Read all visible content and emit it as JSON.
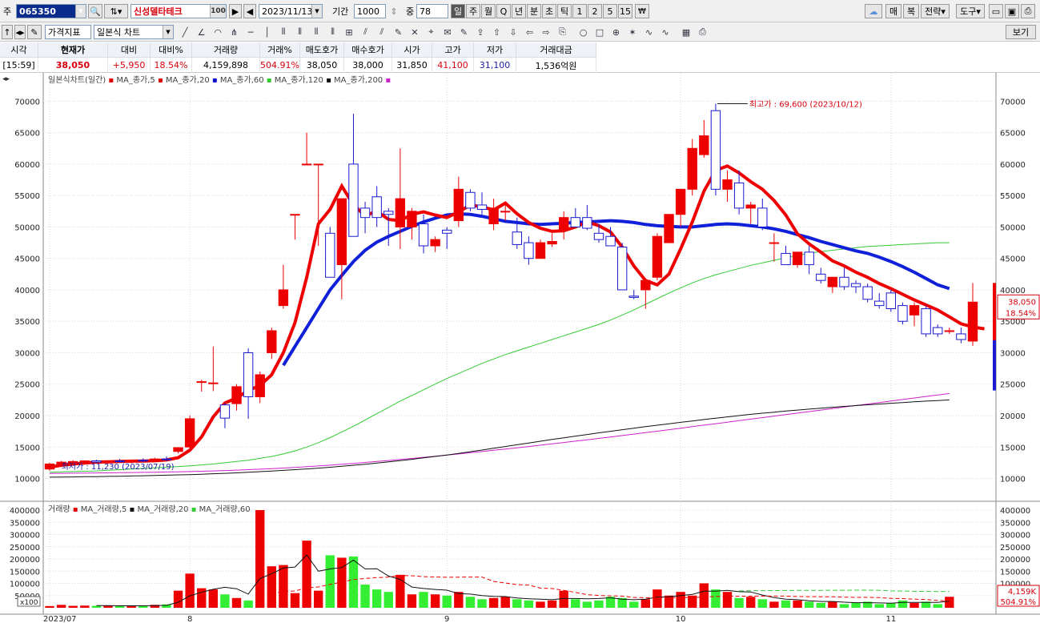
{
  "toolbar": {
    "market_label": "주",
    "stock_code": "065350",
    "stock_name": "신성델타테크",
    "name_badge": "100",
    "date": "2023/11/13",
    "period_label": "기간",
    "period_value": "1000",
    "count_label": "중",
    "count_value": "78",
    "periods": [
      "일",
      "주",
      "월",
      "Q",
      "년",
      "분",
      "초",
      "틱",
      "1",
      "2",
      "5",
      "15"
    ],
    "currency_label": "₩",
    "right_buttons": [
      "매",
      "복",
      "전략",
      "도구"
    ],
    "indicator_select": "가격지표",
    "chart_select": "일본식 차트",
    "view_button": "보기"
  },
  "quote": {
    "headers": [
      "시각",
      "현재가",
      "대비",
      "대비%",
      "거래량",
      "거래%",
      "매도호가",
      "매수호가",
      "시가",
      "고가",
      "저가",
      "거래대금"
    ],
    "values": [
      "[15:59]",
      "38,050",
      "+5,950",
      "18.54%",
      "4,159,898",
      "504.91%",
      "38,050",
      "38,000",
      "31,850",
      "41,100",
      "31,100",
      "1,536억원"
    ]
  },
  "price_panel": {
    "title": "일본식차트(일간)",
    "legend": [
      {
        "label": "MA_종가,5",
        "color": "#e00000"
      },
      {
        "label": "MA_종가,20",
        "color": "#e00000"
      },
      {
        "label": "MA_종가,60",
        "color": "#1010d0"
      },
      {
        "label": "MA_종가,120",
        "color": "#33cc33"
      },
      {
        "label": "MA_종가,200",
        "color": "#111111"
      }
    ],
    "legend_trailing_color": "#cc22cc",
    "yticks": [
      "70000",
      "65000",
      "60000",
      "55000",
      "50000",
      "45000",
      "40000",
      "35000",
      "30000",
      "25000",
      "20000",
      "15000",
      "10000"
    ],
    "high_annotation": "최고가 : 69,600 (2023/10/12)",
    "low_annotation": "최저가 : 11,230 (2023/07/19)",
    "price_tag": "38,050",
    "pct_tag": "18.54%"
  },
  "volume_panel": {
    "title": "거래량",
    "legend": [
      {
        "label": "MA_거래량,5",
        "color": "#e00000"
      },
      {
        "label": "MA_거래량,20",
        "color": "#111111"
      },
      {
        "label": "MA_거래량,60",
        "color": "#33cc33"
      }
    ],
    "yticks": [
      "400000",
      "350000",
      "300000",
      "250000",
      "200000",
      "150000",
      "100000",
      "50000"
    ],
    "unit_label": "x100",
    "volume_tag": "4,159K",
    "pct_tag": "504.91%"
  },
  "xaxis": {
    "labels": [
      "2023/07",
      "8",
      "9",
      "10",
      "11"
    ]
  },
  "colors": {
    "up": "#ee0000",
    "down": "#1a1ad0",
    "ma5": "#ee0000",
    "ma20": "#ee0000",
    "ma60": "#1020d8",
    "ma120": "#33cc33",
    "ma200": "#111111",
    "ma_last": "#cc22cc",
    "vol_up": "#ee0000",
    "vol_down": "#33ee33"
  },
  "chart_data": {
    "type": "candlestick",
    "ylim": [
      6500,
      74000
    ],
    "vol_ylim": [
      0,
      400000
    ],
    "candles": [
      {
        "o": 11500,
        "h": 12500,
        "l": 11200,
        "c": 12300
      },
      {
        "o": 12300,
        "h": 12800,
        "l": 12000,
        "c": 12600
      },
      {
        "o": 12500,
        "h": 12900,
        "l": 12200,
        "c": 12700
      },
      {
        "o": 12600,
        "h": 12900,
        "l": 12300,
        "c": 12800
      },
      {
        "o": 12800,
        "h": 13000,
        "l": 12400,
        "c": 12600
      },
      {
        "o": 12600,
        "h": 12900,
        "l": 12300,
        "c": 12800
      },
      {
        "o": 12800,
        "h": 13100,
        "l": 12500,
        "c": 12700
      },
      {
        "o": 12700,
        "h": 13000,
        "l": 12400,
        "c": 12900
      },
      {
        "o": 12900,
        "h": 13200,
        "l": 12600,
        "c": 12800
      },
      {
        "o": 12800,
        "h": 13300,
        "l": 12600,
        "c": 13100
      },
      {
        "o": 13100,
        "h": 13500,
        "l": 12800,
        "c": 13000
      },
      {
        "o": 14300,
        "h": 15000,
        "l": 14000,
        "c": 14900
      },
      {
        "o": 15000,
        "h": 20000,
        "l": 14800,
        "c": 19500
      },
      {
        "o": 25400,
        "h": 25700,
        "l": 23800,
        "c": 25400
      },
      {
        "o": 25200,
        "h": 31000,
        "l": 23900,
        "c": 25200
      },
      {
        "o": 21700,
        "h": 22000,
        "l": 18000,
        "c": 19600
      },
      {
        "o": 21900,
        "h": 25000,
        "l": 20800,
        "c": 24600
      },
      {
        "o": 30000,
        "h": 30700,
        "l": 19500,
        "c": 23000
      },
      {
        "o": 23000,
        "h": 27000,
        "l": 22000,
        "c": 26500
      },
      {
        "o": 30000,
        "h": 34000,
        "l": 29000,
        "c": 33500
      },
      {
        "o": 37500,
        "h": 44000,
        "l": 37000,
        "c": 40000
      },
      {
        "o": 52000,
        "h": 52000,
        "l": 48000,
        "c": 52000
      },
      {
        "o": 60000,
        "h": 65000,
        "l": 60000,
        "c": 60000
      },
      {
        "o": 60000,
        "h": 60000,
        "l": 47000,
        "c": 60000
      },
      {
        "o": 49000,
        "h": 50000,
        "l": 42000,
        "c": 42000
      },
      {
        "o": 44000,
        "h": 54500,
        "l": 38500,
        "c": 54500
      },
      {
        "o": 60000,
        "h": 68000,
        "l": 48500,
        "c": 48500
      },
      {
        "o": 53000,
        "h": 54000,
        "l": 49000,
        "c": 51500
      },
      {
        "o": 54800,
        "h": 56500,
        "l": 50000,
        "c": 51500
      },
      {
        "o": 52500,
        "h": 53000,
        "l": 47000,
        "c": 52000
      },
      {
        "o": 50000,
        "h": 62500,
        "l": 46500,
        "c": 54500
      },
      {
        "o": 50000,
        "h": 53000,
        "l": 48000,
        "c": 52500
      },
      {
        "o": 50500,
        "h": 52000,
        "l": 45800,
        "c": 47000
      },
      {
        "o": 47000,
        "h": 48500,
        "l": 46000,
        "c": 48000
      },
      {
        "o": 49500,
        "h": 50000,
        "l": 46500,
        "c": 49000
      },
      {
        "o": 51000,
        "h": 58000,
        "l": 50000,
        "c": 56000
      },
      {
        "o": 55500,
        "h": 56000,
        "l": 52500,
        "c": 53000
      },
      {
        "o": 53500,
        "h": 55500,
        "l": 52000,
        "c": 52800
      },
      {
        "o": 50500,
        "h": 54500,
        "l": 49500,
        "c": 53000
      },
      {
        "o": 52500,
        "h": 54000,
        "l": 51000,
        "c": 52500
      },
      {
        "o": 49200,
        "h": 51500,
        "l": 46500,
        "c": 47200
      },
      {
        "o": 47500,
        "h": 48500,
        "l": 44000,
        "c": 45000
      },
      {
        "o": 45000,
        "h": 48000,
        "l": 45000,
        "c": 47500
      },
      {
        "o": 47300,
        "h": 49000,
        "l": 46800,
        "c": 47700
      },
      {
        "o": 49500,
        "h": 52500,
        "l": 48000,
        "c": 51500
      },
      {
        "o": 51500,
        "h": 53000,
        "l": 50000,
        "c": 50000
      },
      {
        "o": 51500,
        "h": 53500,
        "l": 49500,
        "c": 49800
      },
      {
        "o": 49000,
        "h": 50500,
        "l": 47500,
        "c": 48000
      },
      {
        "o": 48500,
        "h": 50000,
        "l": 47000,
        "c": 47000
      },
      {
        "o": 46800,
        "h": 47500,
        "l": 40000,
        "c": 40000
      },
      {
        "o": 39000,
        "h": 40000,
        "l": 38500,
        "c": 38800
      },
      {
        "o": 40000,
        "h": 41500,
        "l": 37000,
        "c": 41500
      },
      {
        "o": 42000,
        "h": 49000,
        "l": 41500,
        "c": 48500
      },
      {
        "o": 47500,
        "h": 52000,
        "l": 47500,
        "c": 52000
      },
      {
        "o": 52000,
        "h": 56000,
        "l": 50000,
        "c": 56000
      },
      {
        "o": 56000,
        "h": 64000,
        "l": 55000,
        "c": 62500
      },
      {
        "o": 61500,
        "h": 67000,
        "l": 61000,
        "c": 64500
      },
      {
        "o": 68500,
        "h": 69600,
        "l": 55000,
        "c": 56000
      },
      {
        "o": 56000,
        "h": 59000,
        "l": 54000,
        "c": 57500
      },
      {
        "o": 57000,
        "h": 59000,
        "l": 52000,
        "c": 53000
      },
      {
        "o": 53000,
        "h": 54000,
        "l": 50500,
        "c": 53500
      },
      {
        "o": 53000,
        "h": 54500,
        "l": 49500,
        "c": 50000
      },
      {
        "o": 47500,
        "h": 49000,
        "l": 44500,
        "c": 47500
      },
      {
        "o": 45800,
        "h": 47000,
        "l": 44000,
        "c": 44000
      },
      {
        "o": 44000,
        "h": 46000,
        "l": 43500,
        "c": 46000
      },
      {
        "o": 46000,
        "h": 47000,
        "l": 42500,
        "c": 44000
      },
      {
        "o": 42500,
        "h": 43500,
        "l": 41000,
        "c": 41500
      },
      {
        "o": 40500,
        "h": 41500,
        "l": 39500,
        "c": 42000
      },
      {
        "o": 42000,
        "h": 43500,
        "l": 40000,
        "c": 40500
      },
      {
        "o": 41000,
        "h": 41500,
        "l": 39500,
        "c": 40500
      },
      {
        "o": 40500,
        "h": 41000,
        "l": 38000,
        "c": 38500
      },
      {
        "o": 38200,
        "h": 39500,
        "l": 37000,
        "c": 37500
      },
      {
        "o": 39500,
        "h": 40000,
        "l": 36500,
        "c": 37000
      },
      {
        "o": 37500,
        "h": 38000,
        "l": 34500,
        "c": 35000
      },
      {
        "o": 36000,
        "h": 38000,
        "l": 34200,
        "c": 37500
      },
      {
        "o": 37000,
        "h": 37500,
        "l": 32500,
        "c": 33000
      },
      {
        "o": 34000,
        "h": 34500,
        "l": 32500,
        "c": 33000
      },
      {
        "o": 33500,
        "h": 34000,
        "l": 33000,
        "c": 33500
      },
      {
        "o": 33000,
        "h": 34000,
        "l": 31500,
        "c": 32100
      },
      {
        "o": 31850,
        "h": 41100,
        "l": 31100,
        "c": 38050
      }
    ],
    "volume": [
      7000,
      12000,
      8000,
      9000,
      8000,
      9000,
      7000,
      8000,
      9000,
      12000,
      14000,
      70000,
      140000,
      80000,
      75000,
      55000,
      40000,
      30000,
      400000,
      170000,
      175000,
      60000,
      275000,
      70000,
      215000,
      205000,
      210000,
      95000,
      75000,
      65000,
      135000,
      55000,
      65000,
      55000,
      50000,
      65000,
      45000,
      35000,
      40000,
      45000,
      35000,
      30000,
      25000,
      30000,
      70000,
      35000,
      25000,
      30000,
      45000,
      40000,
      25000,
      35000,
      75000,
      50000,
      65000,
      50000,
      100000,
      75000,
      65000,
      40000,
      45000,
      35000,
      25000,
      30000,
      30000,
      25000,
      20000,
      25000,
      15000,
      20000,
      25000,
      15000,
      20000,
      30000,
      20000,
      25000,
      15000,
      45000
    ],
    "ma5": [
      11800,
      12100,
      12300,
      12450,
      12600,
      12650,
      12700,
      12750,
      12780,
      12820,
      12950,
      13300,
      14500,
      16600,
      19800,
      22000,
      22800,
      24000,
      24800,
      26500,
      30000,
      34800,
      42000,
      50500,
      52800,
      56500,
      53500,
      51800,
      52500,
      51200,
      51000,
      52000,
      52400,
      51900,
      51500,
      52400,
      53500,
      53200,
      52700,
      53800,
      52100,
      50700,
      49800,
      49300,
      49400,
      50000,
      50800,
      50200,
      49200,
      46800,
      43800,
      41500,
      40800,
      42500,
      46500,
      50800,
      55700,
      59000,
      59700,
      58600,
      57200,
      56000,
      54200,
      51900,
      48900,
      47300,
      46000,
      44600,
      43800,
      42800,
      42000,
      41000,
      40200,
      39300,
      38400,
      37600,
      36800,
      35700,
      34600,
      34100,
      33800
    ],
    "ma20": [
      0,
      0,
      0,
      0,
      0,
      0,
      0,
      0,
      0,
      0,
      0,
      0,
      0,
      0,
      0,
      0,
      0,
      0,
      0,
      0,
      28000,
      31000,
      34000,
      37000,
      40000,
      42300,
      44500,
      46300,
      47600,
      48500,
      49300,
      50100,
      50800,
      51400,
      51900,
      52100,
      52000,
      51700,
      51300,
      50900,
      50700,
      50500,
      50400,
      50500,
      50600,
      50700,
      50800,
      50900,
      51000,
      50900,
      50700,
      50400,
      50200,
      50100,
      50000,
      50000,
      50200,
      50400,
      50500,
      50400,
      50200,
      50000,
      49700,
      49300,
      48800,
      48300,
      47700,
      47200,
      46700,
      46200,
      45800,
      45200,
      44500,
      43700,
      42800,
      41800,
      40800,
      40200
    ],
    "ma60": [
      11000,
      11050,
      11100,
      11150,
      11200,
      11300,
      11400,
      11500,
      11600,
      11700,
      11800,
      11900,
      12000,
      12150,
      12300,
      12500,
      12700,
      12900,
      13200,
      13500,
      13900,
      14400,
      15000,
      15700,
      16500,
      17400,
      18300,
      19300,
      20300,
      21300,
      22300,
      23200,
      24100,
      25000,
      25900,
      26700,
      27500,
      28300,
      29000,
      29700,
      30300,
      30900,
      31500,
      32100,
      32700,
      33300,
      33900,
      34500,
      35200,
      36000,
      36800,
      37700,
      38600,
      39500,
      40300,
      41100,
      41800,
      42400,
      42900,
      43400,
      43900,
      44300,
      44700,
      45100,
      45500,
      45800,
      46100,
      46300,
      46500,
      46700,
      46900,
      47000,
      47100,
      47200,
      47300,
      47400,
      47500,
      47500
    ],
    "ma120": [
      10200,
      10220,
      10250,
      10280,
      10300,
      10330,
      10360,
      10400,
      10440,
      10480,
      10520,
      10570,
      10620,
      10680,
      10750,
      10820,
      10900,
      10990,
      11080,
      11180,
      11290,
      11400,
      11520,
      11650,
      11790,
      11940,
      12100,
      12270,
      12450,
      12640,
      12840,
      13050,
      13270,
      13500,
      13740,
      13990,
      14250,
      14520,
      14800,
      15080,
      15360,
      15640,
      15920,
      16200,
      16470,
      16740,
      17000,
      17260,
      17510,
      17760,
      18000,
      18240,
      18470,
      18700,
      18930,
      19150,
      19370,
      19590,
      19800,
      20000,
      20200,
      20380,
      20550,
      20720,
      20880,
      21030,
      21180,
      21320,
      21460,
      21590,
      21720,
      21840,
      21960,
      22080,
      22190,
      22300,
      22400,
      22500
    ],
    "ma200": [
      10800,
      10820,
      10840,
      10860,
      10880,
      10900,
      10920,
      10940,
      10970,
      11000,
      11030,
      11060,
      11100,
      11150,
      11200,
      11260,
      11330,
      11400,
      11480,
      11570,
      11660,
      11760,
      11870,
      11990,
      12120,
      12260,
      12400,
      12550,
      12700,
      12860,
      13020,
      13190,
      13360,
      13540,
      13720,
      13900,
      14090,
      14280,
      14480,
      14680,
      14880,
      15090,
      15300,
      15510,
      15720,
      15940,
      16160,
      16380,
      16600,
      16830,
      17060,
      17290,
      17520,
      17760,
      18000,
      18240,
      18480,
      18720,
      18960,
      19200,
      19440,
      19680,
      19920,
      20160,
      20400,
      20640,
      20880,
      21120,
      21360,
      21600,
      21840,
      22080,
      22320,
      22560,
      22800,
      23040,
      23280,
      23520
    ],
    "x_label_index": [
      0,
      12,
      34,
      54,
      72
    ]
  }
}
